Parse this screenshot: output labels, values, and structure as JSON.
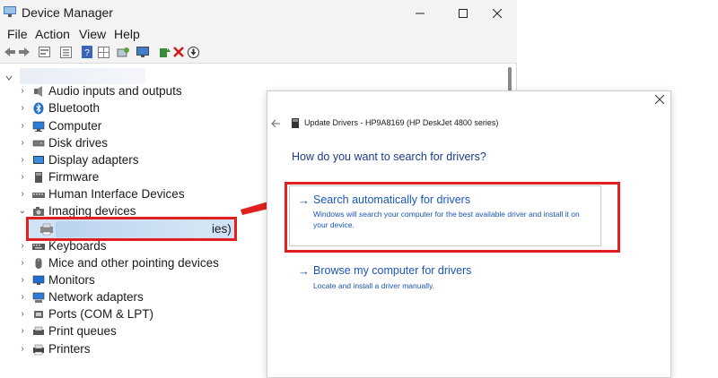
{
  "window": {
    "title": "Device Manager"
  },
  "menu": [
    "File",
    "Action",
    "View",
    "Help"
  ],
  "tree": {
    "items": [
      {
        "label": "Audio inputs and outputs",
        "icon": "speaker-icon",
        "expanded": false
      },
      {
        "label": "Bluetooth",
        "icon": "bluetooth-icon",
        "expanded": false
      },
      {
        "label": "Computer",
        "icon": "computer-icon",
        "expanded": false
      },
      {
        "label": "Disk drives",
        "icon": "disk-drive-icon",
        "expanded": false
      },
      {
        "label": "Display adapters",
        "icon": "display-adapter-icon",
        "expanded": false
      },
      {
        "label": "Firmware",
        "icon": "firmware-icon",
        "expanded": false
      },
      {
        "label": "Human Interface Devices",
        "icon": "hid-icon",
        "expanded": false
      },
      {
        "label": "Imaging devices",
        "icon": "camera-icon",
        "expanded": true
      },
      {
        "label": "Keyboards",
        "icon": "keyboard-icon",
        "expanded": false
      },
      {
        "label": "Mice and other pointing devices",
        "icon": "mouse-icon",
        "expanded": false
      },
      {
        "label": "Monitors",
        "icon": "monitor-icon",
        "expanded": false
      },
      {
        "label": "Network adapters",
        "icon": "network-adapter-icon",
        "expanded": false
      },
      {
        "label": "Ports (COM & LPT)",
        "icon": "port-icon",
        "expanded": false
      },
      {
        "label": "Print queues",
        "icon": "print-queue-icon",
        "expanded": false
      },
      {
        "label": "Printers",
        "icon": "printer-icon",
        "expanded": false
      }
    ],
    "selected_child_tail": "ies)"
  },
  "dialog": {
    "title": "Update Drivers - HP9A8169 (HP DeskJet 4800 series)",
    "question": "How do you want to search for drivers?",
    "option1": {
      "title": "Search automatically for drivers",
      "desc_line1": "Windows will search your computer for the best available driver and install it on",
      "desc_line2": "your device."
    },
    "option2": {
      "title": "Browse my computer for drivers",
      "desc": "Locate and install a driver manually."
    }
  },
  "colors": {
    "accent": "#1a56b8",
    "highlight": "#e02020",
    "selection": "#cfe3f7"
  }
}
